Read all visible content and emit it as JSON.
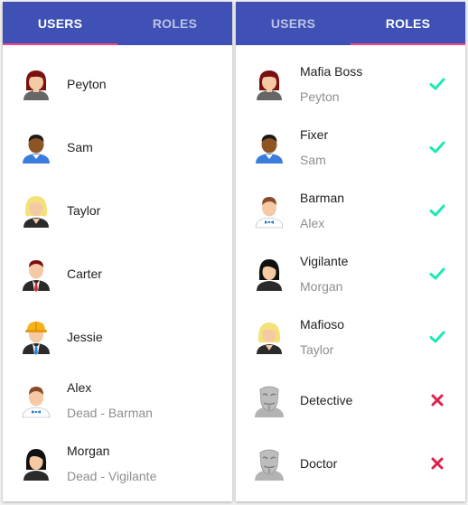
{
  "tabs": {
    "users": "USERS",
    "roles": "ROLES"
  },
  "users_panel": {
    "active_tab": "users",
    "items": [
      {
        "name": "Peyton",
        "subtitle": "",
        "avatar": "woman-red-hair-icon"
      },
      {
        "name": "Sam",
        "subtitle": "",
        "avatar": "man-dark-skin-icon"
      },
      {
        "name": "Taylor",
        "subtitle": "",
        "avatar": "woman-blonde-icon"
      },
      {
        "name": "Carter",
        "subtitle": "",
        "avatar": "man-suit-red-tie-icon"
      },
      {
        "name": "Jessie",
        "subtitle": "",
        "avatar": "construction-worker-icon"
      },
      {
        "name": "Alex",
        "subtitle": "Dead - Barman",
        "avatar": "barman-icon"
      },
      {
        "name": "Morgan",
        "subtitle": "Dead - Vigilante",
        "avatar": "woman-black-hair-icon"
      }
    ]
  },
  "roles_panel": {
    "active_tab": "roles",
    "items": [
      {
        "role": "Mafia Boss",
        "player": "Peyton",
        "status": "check-icon",
        "avatar": "woman-red-hair-icon"
      },
      {
        "role": "Fixer",
        "player": "Sam",
        "status": "check-icon",
        "avatar": "man-dark-skin-icon"
      },
      {
        "role": "Barman",
        "player": "Alex",
        "status": "check-icon",
        "avatar": "barman-icon"
      },
      {
        "role": "Vigilante",
        "player": "Morgan",
        "status": "check-icon",
        "avatar": "woman-black-hair-icon"
      },
      {
        "role": "Mafioso",
        "player": "Taylor",
        "status": "check-icon",
        "avatar": "woman-blonde-icon"
      },
      {
        "role": "Detective",
        "player": "",
        "status": "cross-icon",
        "avatar": "anonymous-mask-icon"
      },
      {
        "role": "Doctor",
        "player": "",
        "status": "cross-icon",
        "avatar": "anonymous-mask-icon"
      }
    ]
  },
  "colors": {
    "tabbar": "#3f51b5",
    "indicator": "#ff4081",
    "check": "#1de9b6",
    "cross": "#e0204a"
  }
}
